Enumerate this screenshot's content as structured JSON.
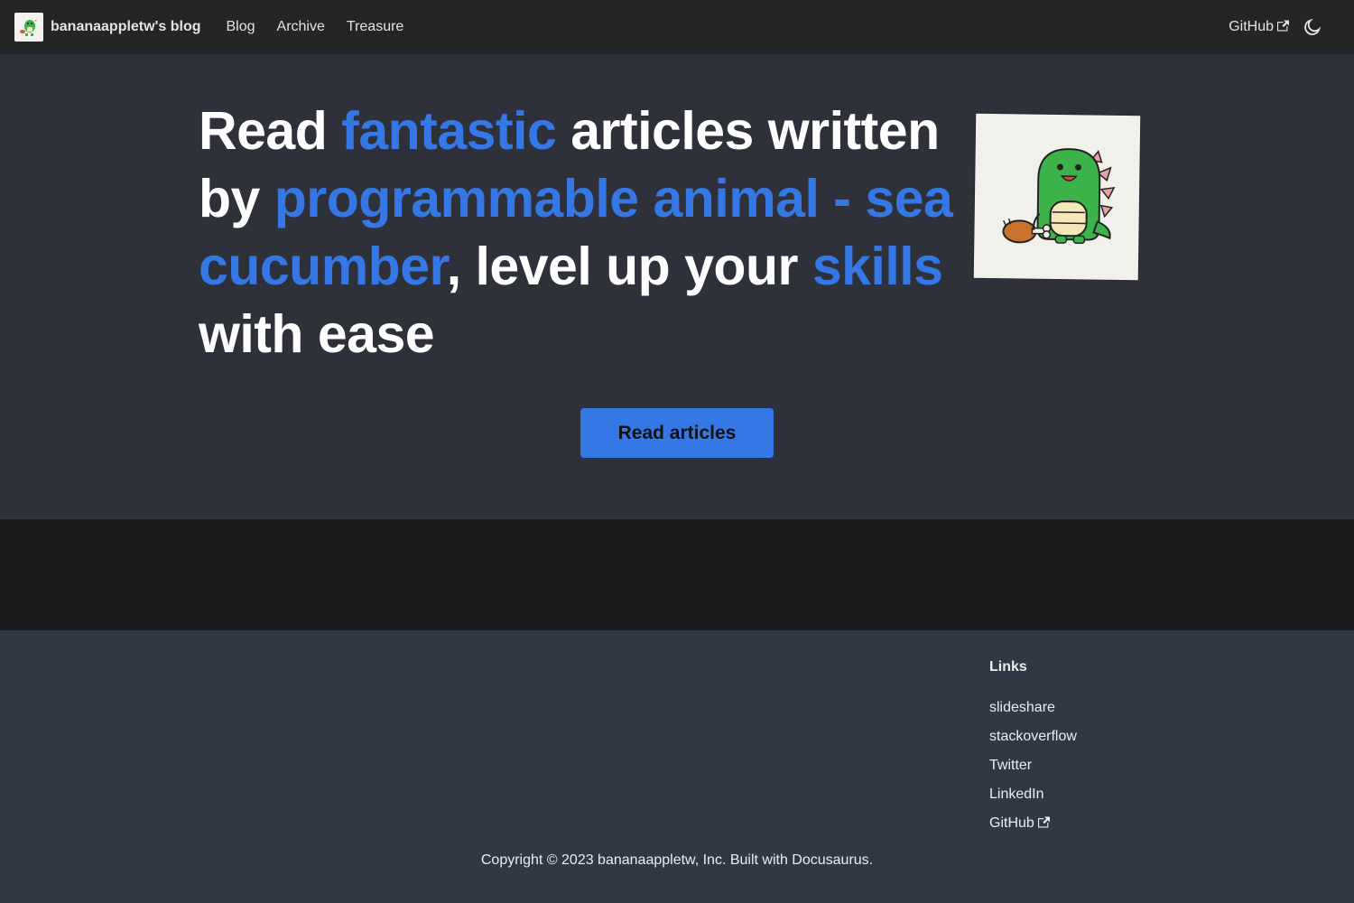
{
  "navbar": {
    "brand_title": "bananaappletw's blog",
    "logo_icon": "dinosaur-logo-icon",
    "links": [
      {
        "label": "Blog"
      },
      {
        "label": "Archive"
      },
      {
        "label": "Treasure"
      }
    ],
    "github_label": "GitHub",
    "external_icon": "external-link-icon",
    "theme_icon": "moon-icon"
  },
  "hero": {
    "title_parts": [
      {
        "text": "Read ",
        "highlight": false
      },
      {
        "text": "fantastic",
        "highlight": true
      },
      {
        "text": " articles written by ",
        "highlight": false
      },
      {
        "text": "programmable animal - sea cucumber",
        "highlight": true
      },
      {
        "text": ", level up your ",
        "highlight": false
      },
      {
        "text": "skills",
        "highlight": true
      },
      {
        "text": " with ease",
        "highlight": false
      }
    ],
    "image_icon": "dinosaur-with-drumstick-illustration",
    "cta_label": "Read articles"
  },
  "footer": {
    "heading": "Links",
    "links": [
      {
        "label": "slideshare"
      },
      {
        "label": "stackoverflow"
      },
      {
        "label": "Twitter"
      },
      {
        "label": "LinkedIn"
      },
      {
        "label": "GitHub"
      }
    ],
    "copyright": "Copyright © 2023 bananaappletw, Inc. Built with Docusaurus."
  },
  "colors": {
    "accent": "#3578e5",
    "navbar_bg": "#242526",
    "hero_bg": "#2e313a",
    "footer_bg": "#303846"
  }
}
